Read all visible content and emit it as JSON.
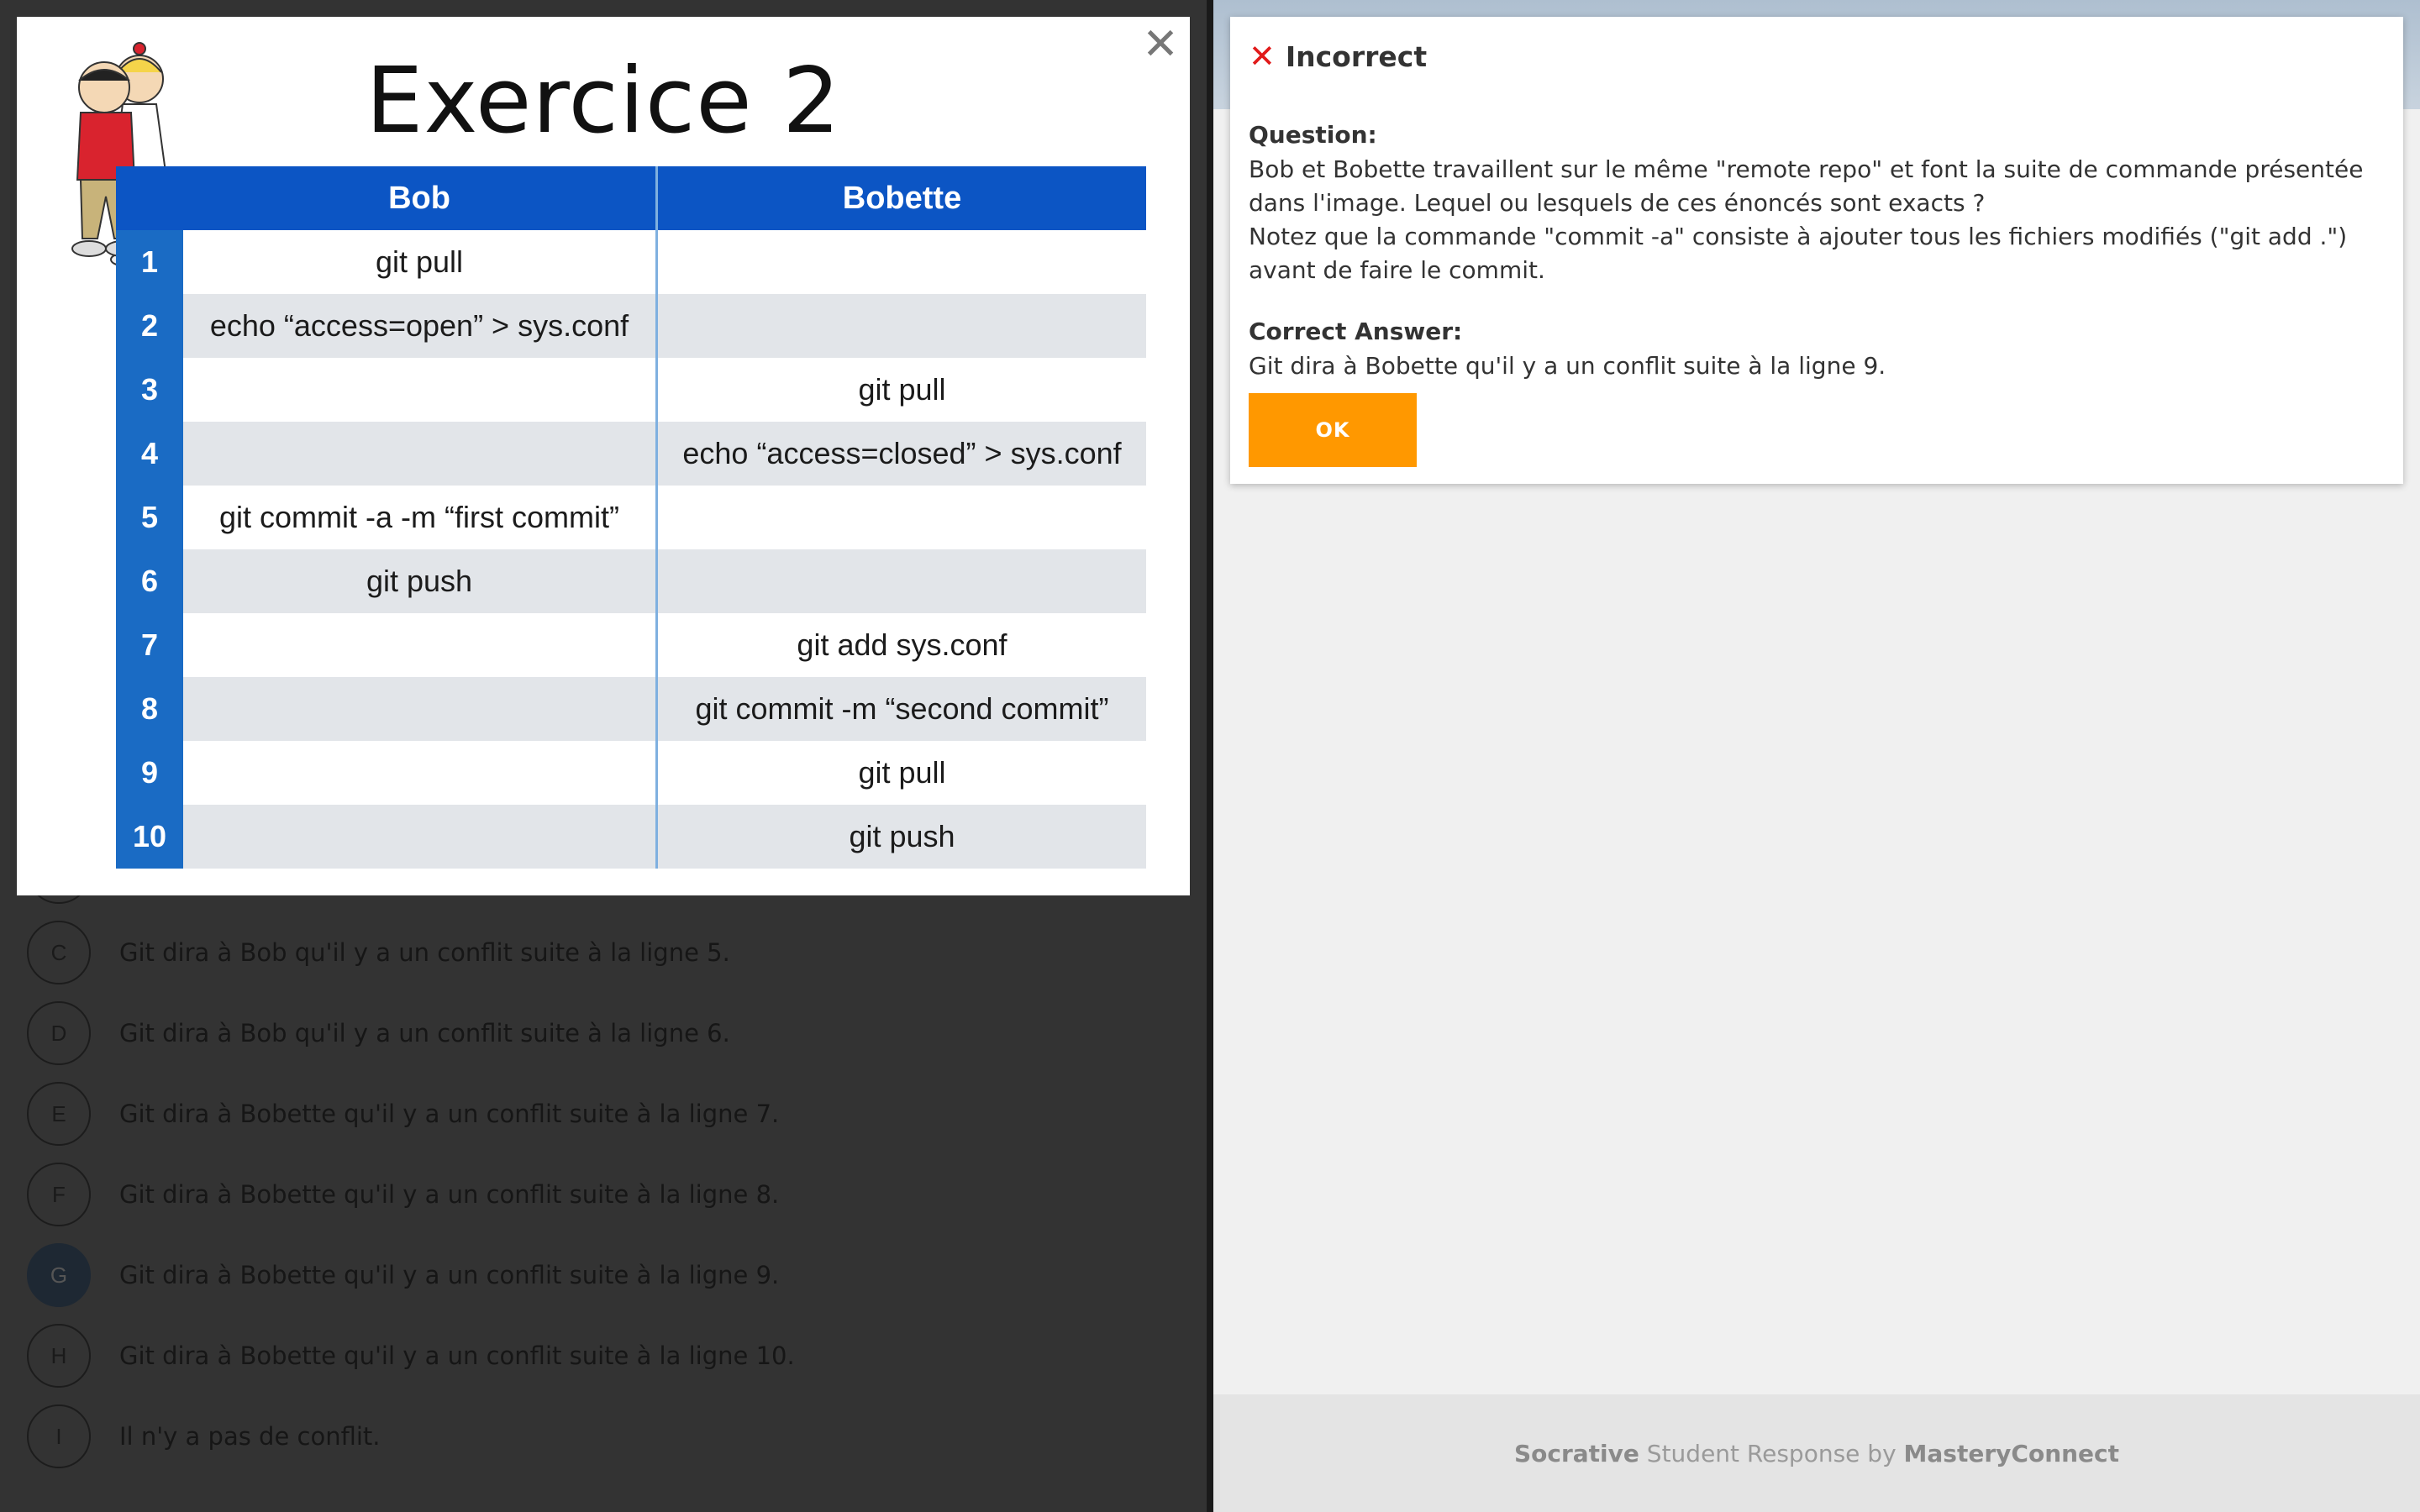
{
  "image": {
    "title": "Exercice 2",
    "headers": [
      "Bob",
      "Bobette"
    ],
    "rows": [
      {
        "n": "1",
        "bob": "git pull",
        "bobette": ""
      },
      {
        "n": "2",
        "bob": "echo “access=open” > sys.conf",
        "bobette": ""
      },
      {
        "n": "3",
        "bob": "",
        "bobette": "git pull"
      },
      {
        "n": "4",
        "bob": "",
        "bobette": "echo “access=closed” > sys.conf"
      },
      {
        "n": "5",
        "bob": "git commit -a -m “first commit”",
        "bobette": ""
      },
      {
        "n": "6",
        "bob": "git push",
        "bobette": ""
      },
      {
        "n": "7",
        "bob": "",
        "bobette": "git add sys.conf"
      },
      {
        "n": "8",
        "bob": "",
        "bobette": "git commit -m “second commit”"
      },
      {
        "n": "9",
        "bob": "",
        "bobette": "git pull"
      },
      {
        "n": "10",
        "bob": "",
        "bobette": "git push"
      }
    ],
    "close_icon": "close-icon"
  },
  "answers": [
    {
      "letter": "C",
      "text": "Git dira à Bob qu'il y a un conflit suite à la ligne 5."
    },
    {
      "letter": "D",
      "text": "Git dira à Bob qu'il y a un conflit suite à la ligne 6."
    },
    {
      "letter": "E",
      "text": "Git dira à Bobette qu'il y a un conflit suite à la ligne 7."
    },
    {
      "letter": "F",
      "text": "Git dira à Bobette qu'il y a un conflit suite à la ligne 8."
    },
    {
      "letter": "G",
      "text": "Git dira à Bobette qu'il y a un conflit suite à la ligne 9."
    },
    {
      "letter": "H",
      "text": "Git dira à Bobette qu'il y a un conflit suite à la ligne 10."
    },
    {
      "letter": "I",
      "text": "Il n'y a pas de conflit."
    }
  ],
  "selected_answer": "G",
  "result": {
    "status": "Incorrect",
    "status_color": "#e11a1a",
    "question_label": "Question:",
    "question_line1": "Bob et Bobette travaillent sur le même \"remote repo\" et font la suite de commande présentée dans l'image. Lequel ou lesquels de ces énoncés sont exacts ?",
    "question_line2": "Notez que la commande \"commit -a\" consiste à ajouter tous les fichiers modifiés (\"git add .\") avant de faire le commit.",
    "correct_label": "Correct Answer:",
    "correct_text": "Git dira à Bobette qu'il y a un conflit suite à la ligne 9.",
    "ok_label": "OK",
    "ok_color": "#ff9800"
  },
  "footer": {
    "brand": "Socrative",
    "middle": " Student Response by ",
    "company": "MasteryConnect"
  }
}
